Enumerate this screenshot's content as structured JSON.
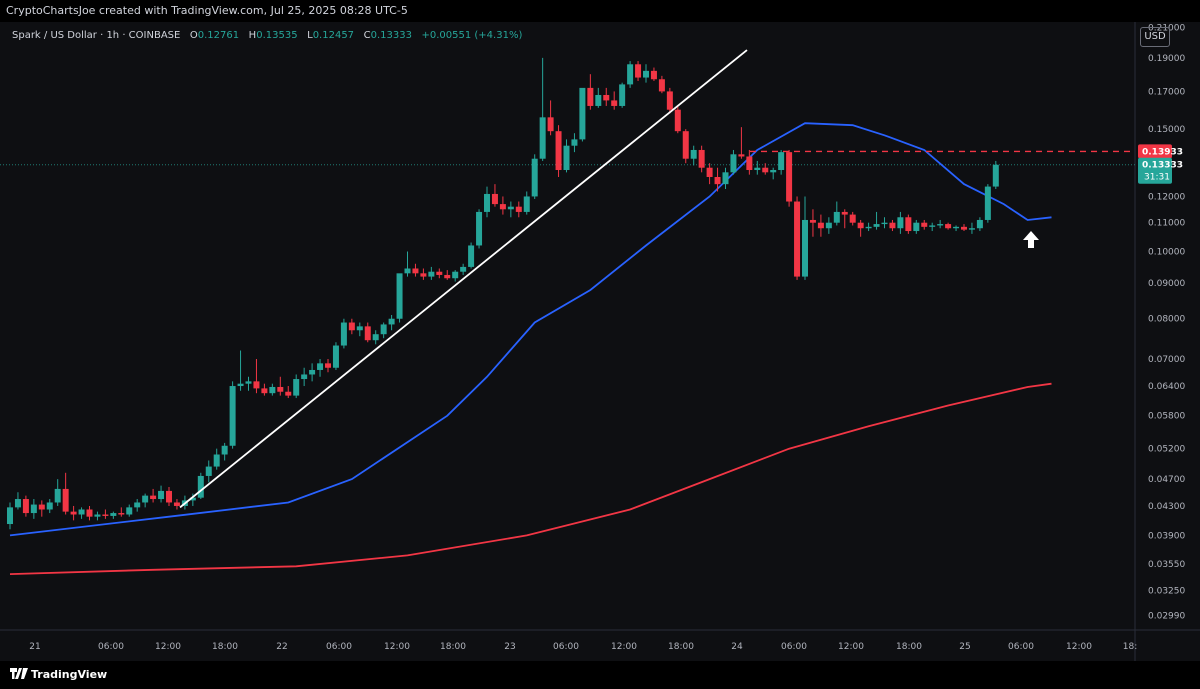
{
  "header": {
    "credit": "CryptoChartsJoe created with TradingView.com, Jul 25, 2025 08:28 UTC-5"
  },
  "legend": {
    "symbol": "Spark / US Dollar · 1h · COINBASE",
    "open_label": "O",
    "open": "0.12761",
    "high_label": "H",
    "high": "0.13535",
    "low_label": "L",
    "low": "0.12457",
    "close_label": "C",
    "close": "0.13333",
    "change": "+0.00551 (+4.31%)"
  },
  "currency_button": "USD",
  "footer": {
    "brand": "TradingView"
  },
  "colors": {
    "background": "#0e0f12",
    "up": "#26a69a",
    "down": "#f23645",
    "ema_fast": "#2962ff",
    "ema_slow": "#f23645",
    "trendline": "#ffffff",
    "resistance": "#f23645"
  },
  "chart_data": {
    "type": "candlestick",
    "title": "Spark / US Dollar · 1h · COINBASE",
    "y_scale": "log",
    "ylim": [
      0.0285,
      0.214
    ],
    "y_ticks": [
      "0.21000",
      "0.19000",
      "0.17000",
      "0.15000",
      "0.12000",
      "0.11000",
      "0.10000",
      "0.09000",
      "0.08000",
      "0.07000",
      "0.06400",
      "0.05800",
      "0.05200",
      "0.04700",
      "0.04300",
      "0.03900",
      "0.03550",
      "0.03250",
      "0.02990"
    ],
    "x_ticks": [
      "21",
      "06:00",
      "12:00",
      "18:00",
      "22",
      "06:00",
      "12:00",
      "18:00",
      "23",
      "06:00",
      "12:00",
      "18:00",
      "24",
      "06:00",
      "12:00",
      "18:00",
      "25",
      "06:00",
      "12:00",
      "18:"
    ],
    "price_labels": [
      {
        "label": "0.13933",
        "value": 0.13933,
        "color": "#f23645"
      },
      {
        "label": "0.13333",
        "value": 0.13333,
        "color": "#26a69a",
        "countdown": "31:31"
      }
    ],
    "resistance_level": 0.13933,
    "current_price": 0.13333,
    "candles": [
      [
        0.0405,
        0.0435,
        0.0398,
        0.0428
      ],
      [
        0.0428,
        0.045,
        0.0425,
        0.044
      ],
      [
        0.044,
        0.0445,
        0.0415,
        0.042
      ],
      [
        0.042,
        0.044,
        0.0412,
        0.0432
      ],
      [
        0.0432,
        0.0438,
        0.0415,
        0.0425
      ],
      [
        0.0425,
        0.044,
        0.042,
        0.0435
      ],
      [
        0.0435,
        0.047,
        0.043,
        0.0455
      ],
      [
        0.0455,
        0.048,
        0.0418,
        0.0422
      ],
      [
        0.0422,
        0.043,
        0.041,
        0.0418
      ],
      [
        0.0418,
        0.0428,
        0.0412,
        0.0425
      ],
      [
        0.0425,
        0.043,
        0.041,
        0.0415
      ],
      [
        0.0415,
        0.0422,
        0.041,
        0.0418
      ],
      [
        0.0418,
        0.0425,
        0.0412,
        0.0416
      ],
      [
        0.0416,
        0.0422,
        0.0412,
        0.042
      ],
      [
        0.042,
        0.0428,
        0.0415,
        0.0418
      ],
      [
        0.0418,
        0.0432,
        0.0415,
        0.0428
      ],
      [
        0.0428,
        0.044,
        0.0422,
        0.0435
      ],
      [
        0.0435,
        0.0448,
        0.0428,
        0.0445
      ],
      [
        0.0445,
        0.0455,
        0.0435,
        0.044
      ],
      [
        0.044,
        0.046,
        0.0435,
        0.0452
      ],
      [
        0.0452,
        0.0458,
        0.043,
        0.0435
      ],
      [
        0.0435,
        0.044,
        0.0425,
        0.043
      ],
      [
        0.043,
        0.0445,
        0.0425,
        0.0438
      ],
      [
        0.0438,
        0.0448,
        0.043,
        0.0442
      ],
      [
        0.0442,
        0.048,
        0.044,
        0.0475
      ],
      [
        0.0475,
        0.05,
        0.0465,
        0.049
      ],
      [
        0.049,
        0.052,
        0.0485,
        0.051
      ],
      [
        0.051,
        0.053,
        0.05,
        0.0525
      ],
      [
        0.0525,
        0.065,
        0.052,
        0.064
      ],
      [
        0.064,
        0.072,
        0.063,
        0.0645
      ],
      [
        0.0645,
        0.066,
        0.063,
        0.065
      ],
      [
        0.065,
        0.07,
        0.0625,
        0.0635
      ],
      [
        0.0635,
        0.0645,
        0.062,
        0.0625
      ],
      [
        0.0625,
        0.0645,
        0.062,
        0.0638
      ],
      [
        0.0638,
        0.066,
        0.062,
        0.0628
      ],
      [
        0.0628,
        0.064,
        0.0615,
        0.062
      ],
      [
        0.062,
        0.0665,
        0.0615,
        0.0655
      ],
      [
        0.0655,
        0.068,
        0.064,
        0.0665
      ],
      [
        0.0665,
        0.069,
        0.065,
        0.0675
      ],
      [
        0.0675,
        0.07,
        0.066,
        0.069
      ],
      [
        0.069,
        0.07,
        0.067,
        0.068
      ],
      [
        0.068,
        0.074,
        0.0675,
        0.0732
      ],
      [
        0.0732,
        0.08,
        0.0725,
        0.079
      ],
      [
        0.079,
        0.08,
        0.076,
        0.077
      ],
      [
        0.077,
        0.079,
        0.0755,
        0.078
      ],
      [
        0.078,
        0.079,
        0.074,
        0.0745
      ],
      [
        0.0745,
        0.077,
        0.0735,
        0.076
      ],
      [
        0.076,
        0.079,
        0.075,
        0.0785
      ],
      [
        0.0785,
        0.081,
        0.077,
        0.08
      ],
      [
        0.08,
        0.09,
        0.079,
        0.093
      ],
      [
        0.093,
        0.1,
        0.092,
        0.0945
      ],
      [
        0.0945,
        0.096,
        0.092,
        0.093
      ],
      [
        0.093,
        0.0945,
        0.091,
        0.092
      ],
      [
        0.092,
        0.095,
        0.091,
        0.0935
      ],
      [
        0.0935,
        0.0945,
        0.0915,
        0.0925
      ],
      [
        0.0925,
        0.094,
        0.091,
        0.0915
      ],
      [
        0.0915,
        0.094,
        0.0905,
        0.0935
      ],
      [
        0.0935,
        0.096,
        0.0925,
        0.095
      ],
      [
        0.095,
        0.103,
        0.0945,
        0.102
      ],
      [
        0.102,
        0.115,
        0.101,
        0.114
      ],
      [
        0.114,
        0.124,
        0.112,
        0.121
      ],
      [
        0.121,
        0.125,
        0.116,
        0.117
      ],
      [
        0.117,
        0.12,
        0.113,
        0.115
      ],
      [
        0.115,
        0.118,
        0.112,
        0.116
      ],
      [
        0.116,
        0.118,
        0.112,
        0.114
      ],
      [
        0.114,
        0.122,
        0.113,
        0.12
      ],
      [
        0.12,
        0.138,
        0.119,
        0.136
      ],
      [
        0.136,
        0.19,
        0.135,
        0.156
      ],
      [
        0.156,
        0.165,
        0.147,
        0.149
      ],
      [
        0.149,
        0.152,
        0.128,
        0.131
      ],
      [
        0.131,
        0.145,
        0.13,
        0.142
      ],
      [
        0.142,
        0.148,
        0.139,
        0.145
      ],
      [
        0.145,
        0.16,
        0.144,
        0.172
      ],
      [
        0.172,
        0.18,
        0.16,
        0.162
      ],
      [
        0.162,
        0.172,
        0.161,
        0.168
      ],
      [
        0.168,
        0.172,
        0.162,
        0.165
      ],
      [
        0.165,
        0.17,
        0.16,
        0.162
      ],
      [
        0.162,
        0.175,
        0.161,
        0.174
      ],
      [
        0.174,
        0.188,
        0.172,
        0.186
      ],
      [
        0.186,
        0.188,
        0.176,
        0.178
      ],
      [
        0.178,
        0.186,
        0.175,
        0.182
      ],
      [
        0.182,
        0.184,
        0.176,
        0.177
      ],
      [
        0.177,
        0.179,
        0.169,
        0.17
      ],
      [
        0.17,
        0.172,
        0.158,
        0.16
      ],
      [
        0.16,
        0.162,
        0.148,
        0.149
      ],
      [
        0.149,
        0.15,
        0.134,
        0.136
      ],
      [
        0.136,
        0.142,
        0.133,
        0.14
      ],
      [
        0.14,
        0.142,
        0.13,
        0.132
      ],
      [
        0.132,
        0.134,
        0.125,
        0.128
      ],
      [
        0.128,
        0.132,
        0.122,
        0.125
      ],
      [
        0.125,
        0.132,
        0.123,
        0.13
      ],
      [
        0.13,
        0.14,
        0.129,
        0.138
      ],
      [
        0.138,
        0.151,
        0.136,
        0.137
      ],
      [
        0.137,
        0.14,
        0.129,
        0.131
      ],
      [
        0.131,
        0.135,
        0.129,
        0.132
      ],
      [
        0.132,
        0.134,
        0.129,
        0.13
      ],
      [
        0.13,
        0.132,
        0.127,
        0.131
      ],
      [
        0.131,
        0.14,
        0.129,
        0.139
      ],
      [
        0.139,
        0.14,
        0.116,
        0.118
      ],
      [
        0.118,
        0.12,
        0.091,
        0.092
      ],
      [
        0.092,
        0.12,
        0.091,
        0.111
      ],
      [
        0.111,
        0.115,
        0.105,
        0.11
      ],
      [
        0.11,
        0.113,
        0.105,
        0.108
      ],
      [
        0.108,
        0.112,
        0.106,
        0.11
      ],
      [
        0.11,
        0.118,
        0.109,
        0.114
      ],
      [
        0.114,
        0.115,
        0.108,
        0.113
      ],
      [
        0.113,
        0.114,
        0.109,
        0.11
      ],
      [
        0.11,
        0.111,
        0.105,
        0.108
      ],
      [
        0.108,
        0.11,
        0.107,
        0.1085
      ],
      [
        0.1085,
        0.114,
        0.1075,
        0.1095
      ],
      [
        0.1095,
        0.112,
        0.108,
        0.11
      ],
      [
        0.11,
        0.111,
        0.107,
        0.108
      ],
      [
        0.108,
        0.114,
        0.106,
        0.112
      ],
      [
        0.112,
        0.113,
        0.106,
        0.107
      ],
      [
        0.107,
        0.111,
        0.106,
        0.11
      ],
      [
        0.11,
        0.111,
        0.1075,
        0.1085
      ],
      [
        0.1085,
        0.11,
        0.107,
        0.109
      ],
      [
        0.109,
        0.111,
        0.108,
        0.1095
      ],
      [
        0.1095,
        0.11,
        0.1075,
        0.108
      ],
      [
        0.108,
        0.109,
        0.107,
        0.1085
      ],
      [
        0.1085,
        0.1095,
        0.107,
        0.1075
      ],
      [
        0.1075,
        0.11,
        0.106,
        0.108
      ],
      [
        0.108,
        0.112,
        0.107,
        0.111
      ],
      [
        0.111,
        0.125,
        0.11,
        0.124
      ],
      [
        0.124,
        0.135,
        0.123,
        0.1333
      ]
    ],
    "series": [
      {
        "name": "",
        "color": "#2962ff",
        "points": [
          [
            0,
            0.039
          ],
          [
            20,
            0.0415
          ],
          [
            35,
            0.0435
          ],
          [
            43,
            0.047
          ],
          [
            55,
            0.058
          ],
          [
            60,
            0.066
          ],
          [
            66,
            0.079
          ],
          [
            73,
            0.088
          ],
          [
            80,
            0.102
          ],
          [
            88,
            0.12
          ],
          [
            94,
            0.14
          ],
          [
            100,
            0.153
          ],
          [
            106,
            0.152
          ],
          [
            110,
            0.147
          ],
          [
            115,
            0.14
          ],
          [
            120,
            0.125
          ],
          [
            125,
            0.117
          ],
          [
            128,
            0.111
          ],
          [
            131,
            0.112
          ]
        ]
      },
      {
        "name": "",
        "color": "#f23645",
        "points": [
          [
            0,
            0.0343
          ],
          [
            18,
            0.0348
          ],
          [
            36,
            0.0352
          ],
          [
            50,
            0.0365
          ],
          [
            65,
            0.039
          ],
          [
            78,
            0.0425
          ],
          [
            88,
            0.047
          ],
          [
            98,
            0.052
          ],
          [
            108,
            0.056
          ],
          [
            118,
            0.06
          ],
          [
            128,
            0.0638
          ],
          [
            131,
            0.0645
          ]
        ]
      }
    ]
  }
}
